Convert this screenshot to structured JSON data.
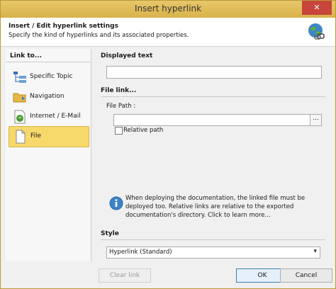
{
  "window": {
    "title": "Insert hyperlink",
    "close_glyph": "✕"
  },
  "header": {
    "title": "Insert / Edit hyperlink settings",
    "subtitle": "Specify the kind of hyperlinks and its associated properties.",
    "icon": "globe-link-icon"
  },
  "sidebar": {
    "heading": "Link to...",
    "selected": "File",
    "items": [
      {
        "label": "Specific Topic",
        "icon": "topic-tree-icon"
      },
      {
        "label": "Navigation",
        "icon": "navigation-folder-icon"
      },
      {
        "label": "Internet / E-Mail",
        "icon": "internet-email-icon"
      },
      {
        "label": "File",
        "icon": "file-icon"
      }
    ]
  },
  "displayed_text": {
    "title": "Displayed text",
    "value": ""
  },
  "file_link": {
    "title": "File link...",
    "path_label": "File Path :",
    "path_value": "",
    "browse_label": "...",
    "relative_label": "Relative path",
    "relative_checked": false
  },
  "info": {
    "icon": "info-icon",
    "text": "When deploying the documentation, the linked file must be deployed too. Relative links are relative to the exported documentation's directory. Click to learn more..."
  },
  "style": {
    "title": "Style",
    "selected": "Hyperlink (Standard)",
    "chevron": "▾"
  },
  "footer": {
    "clear_label": "Clear link",
    "ok_label": "OK",
    "cancel_label": "Cancel"
  },
  "colors": {
    "titlebar": "#e0be5a",
    "close": "#c7453a",
    "selection": "#f7d86b"
  }
}
